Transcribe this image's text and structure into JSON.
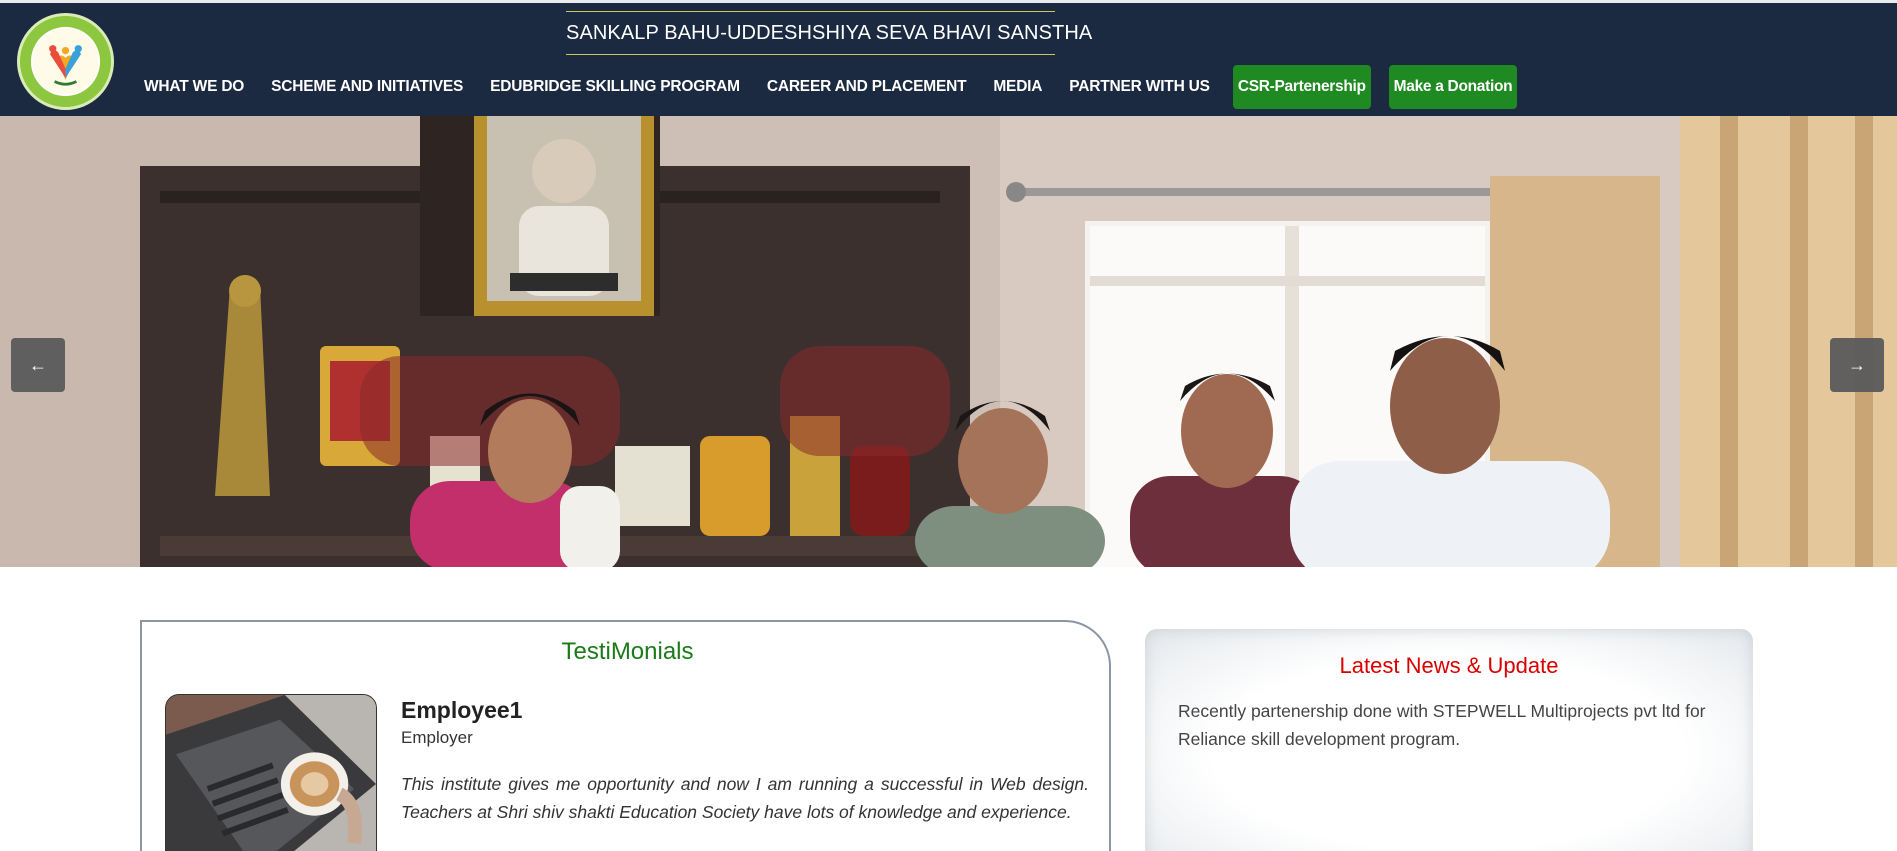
{
  "header": {
    "site_title": "SANKALP BAHU-UDDESHSHIYA SEVA BHAVI SANSTHA",
    "logo_icon": "organization-logo-icon",
    "nav_items": [
      {
        "label": "WHAT WE DO"
      },
      {
        "label": "SCHEME AND INITIATIVES"
      },
      {
        "label": "EDUBRIDGE SKILLING PROGRAM"
      },
      {
        "label": "CAREER AND PLACEMENT"
      },
      {
        "label": "MEDIA"
      },
      {
        "label": "PARTNER WITH US"
      }
    ],
    "csr_button": "CSR-Partenership",
    "donate_button": "Make a Donation",
    "colors": {
      "header_bg": "#1b2a41",
      "button_green": "#1f8a21",
      "title_rule": "#c7c95a"
    }
  },
  "carousel": {
    "prev_icon": "arrow-left-icon",
    "next_icon": "arrow-right-icon",
    "prev_glyph": "←",
    "next_glyph": "→"
  },
  "testimonials": {
    "heading": "TestiMonials",
    "name": "Employee1",
    "role": "Employer",
    "quote": "This institute gives me opportunity and now I am running a successful in Web design. Teachers at Shri shiv shakti Education Society have lots of knowledge and experience.",
    "colors": {
      "heading": "#1a7b1a"
    }
  },
  "news": {
    "heading": "Latest News & Update",
    "text": "Recently partenership done with STEPWELL Multiprojects pvt ltd for Reliance skill development program.",
    "colors": {
      "heading": "#d90000"
    }
  }
}
